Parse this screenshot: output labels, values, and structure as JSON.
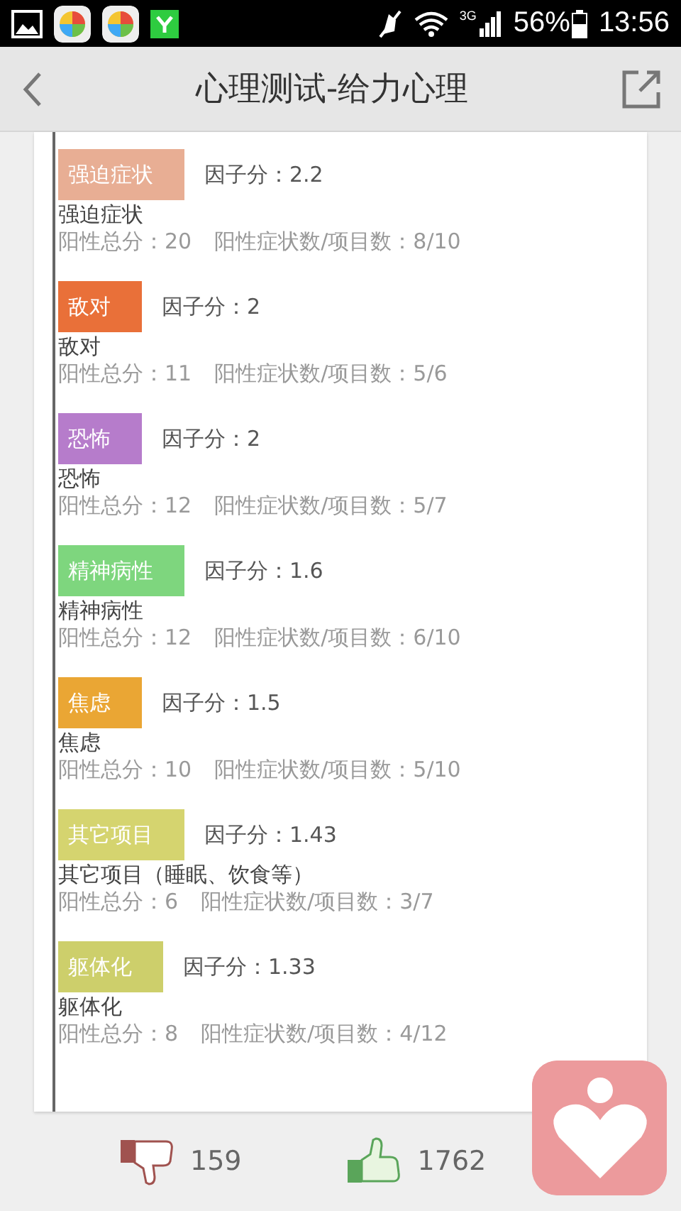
{
  "status_bar": {
    "network": "3G",
    "battery": "56%",
    "time": "13:56"
  },
  "header": {
    "title": "心理测试-给力心理"
  },
  "factors": [
    {
      "name": "强迫症状",
      "score": "因子分：2.2",
      "color": "#e8ae94",
      "detail_name": "强迫症状",
      "positive_total": "阳性总分：20",
      "ratio": "阳性症状数/项目数：8/10"
    },
    {
      "name": "敌对",
      "score": "因子分：2",
      "color": "#e97039",
      "detail_name": "敌对",
      "positive_total": "阳性总分：11",
      "ratio": "阳性症状数/项目数：5/6"
    },
    {
      "name": "恐怖",
      "score": "因子分：2",
      "color": "#b67ccb",
      "detail_name": "恐怖",
      "positive_total": "阳性总分：12",
      "ratio": "阳性症状数/项目数：5/7"
    },
    {
      "name": "精神病性",
      "score": "因子分：1.6",
      "color": "#7ed67e",
      "detail_name": "精神病性",
      "positive_total": "阳性总分：12",
      "ratio": "阳性症状数/项目数：6/10"
    },
    {
      "name": "焦虑",
      "score": "因子分：1.5",
      "color": "#eaa634",
      "detail_name": "焦虑",
      "positive_total": "阳性总分：10",
      "ratio": "阳性症状数/项目数：5/10"
    },
    {
      "name": "其它项目",
      "score": "因子分：1.43",
      "color": "#d5d46f",
      "detail_name": "其它项目（睡眠、饮食等）",
      "positive_total": "阳性总分：6",
      "ratio": "阳性症状数/项目数：3/7"
    },
    {
      "name": "躯体化",
      "score": "因子分：1.33",
      "color": "#cdcf6b",
      "detail_name": "躯体化",
      "positive_total": "阳性总分：8",
      "ratio": "阳性症状数/项目数：4/12"
    }
  ],
  "footer": {
    "dislikes": "159",
    "likes": "1762"
  }
}
